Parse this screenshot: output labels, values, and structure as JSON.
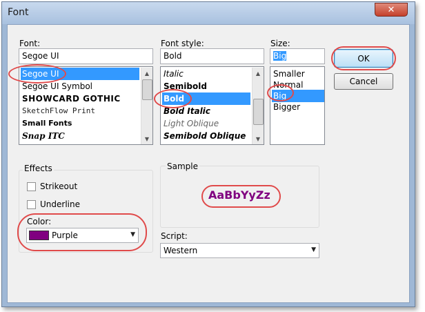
{
  "window": {
    "title": "Font",
    "close_glyph": "✕"
  },
  "font": {
    "label": "Font:",
    "value": "Segoe UI",
    "items": [
      "Segoe UI",
      "Segoe UI Symbol",
      "SHOWCARD GOTHIC",
      "SketchFlow Print",
      "Small Fonts",
      "Snap ITC"
    ],
    "selected_index": 0
  },
  "font_style": {
    "label": "Font style:",
    "value": "Bold",
    "items": [
      "Italic",
      "Semibold",
      "Bold",
      "Bold Italic",
      "Light Oblique",
      "Semibold Oblique"
    ],
    "selected_index": 2
  },
  "size": {
    "label": "Size:",
    "value": "Big",
    "items": [
      "Smaller",
      "Normal",
      "Big",
      "Bigger"
    ],
    "selected_index": 2
  },
  "buttons": {
    "ok": "OK",
    "cancel": "Cancel"
  },
  "effects": {
    "label": "Effects",
    "strikeout": "Strikeout",
    "strikeout_checked": false,
    "underline": "Underline",
    "underline_checked": false,
    "color_label": "Color:",
    "color_value": "Purple",
    "color_hex": "#800080"
  },
  "sample": {
    "label": "Sample",
    "text": "AaBbYyZz",
    "color": "#800080"
  },
  "script": {
    "label": "Script:",
    "value": "Western"
  },
  "colors": {
    "highlight": "#3399ff",
    "annotation": "#e04a4a"
  },
  "icons": {
    "scroll_up": "scroll-up-arrow-icon",
    "scroll_down": "scroll-down-arrow-icon",
    "dropdown": "chevron-down-icon"
  }
}
